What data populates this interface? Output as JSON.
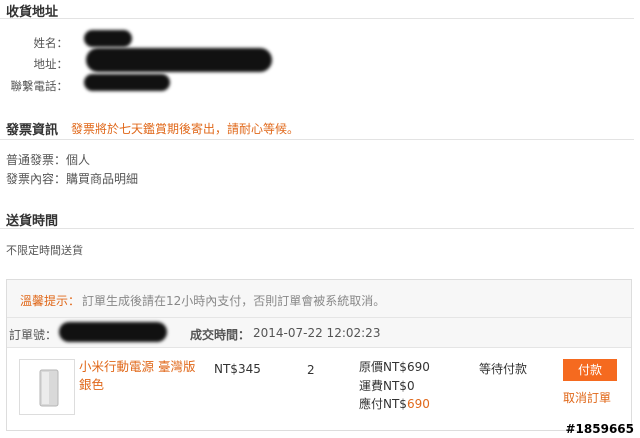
{
  "shipping": {
    "title": "收貨地址",
    "name_label": "姓名：",
    "address_label": "地址：",
    "phone_label": "聯繫電話："
  },
  "invoice": {
    "title": "發票資訊",
    "notice": "發票將於七天鑑賞期後寄出，請耐心等候。",
    "type_line": "普通發票：個人",
    "content_line": "發票內容：購買商品明細"
  },
  "delivery": {
    "title": "送貨時間",
    "value": "不限定時間送貨"
  },
  "order": {
    "notice_label": "溫馨提示：",
    "notice_text": "訂單生成後請在12小時內支付，否則訂單會被系統取消。",
    "order_no_label": "訂單號：",
    "time_label": "成交時間：",
    "time_value": "2014-07-22 12:02:23",
    "item": {
      "name": "小米行動電源 臺灣版 銀色",
      "unit_price": "NT$345",
      "quantity": "2",
      "original_label": "原價NT$690",
      "shipping_label": "運費NT$0",
      "payable_prefix": "應付NT$",
      "payable_value": "690",
      "status": "等待付款",
      "pay_button": "付款",
      "cancel_link": "取消訂單"
    }
  },
  "watermark": "#1859665",
  "colors": {
    "accent": "#e0681a",
    "button": "#f56a1f"
  }
}
